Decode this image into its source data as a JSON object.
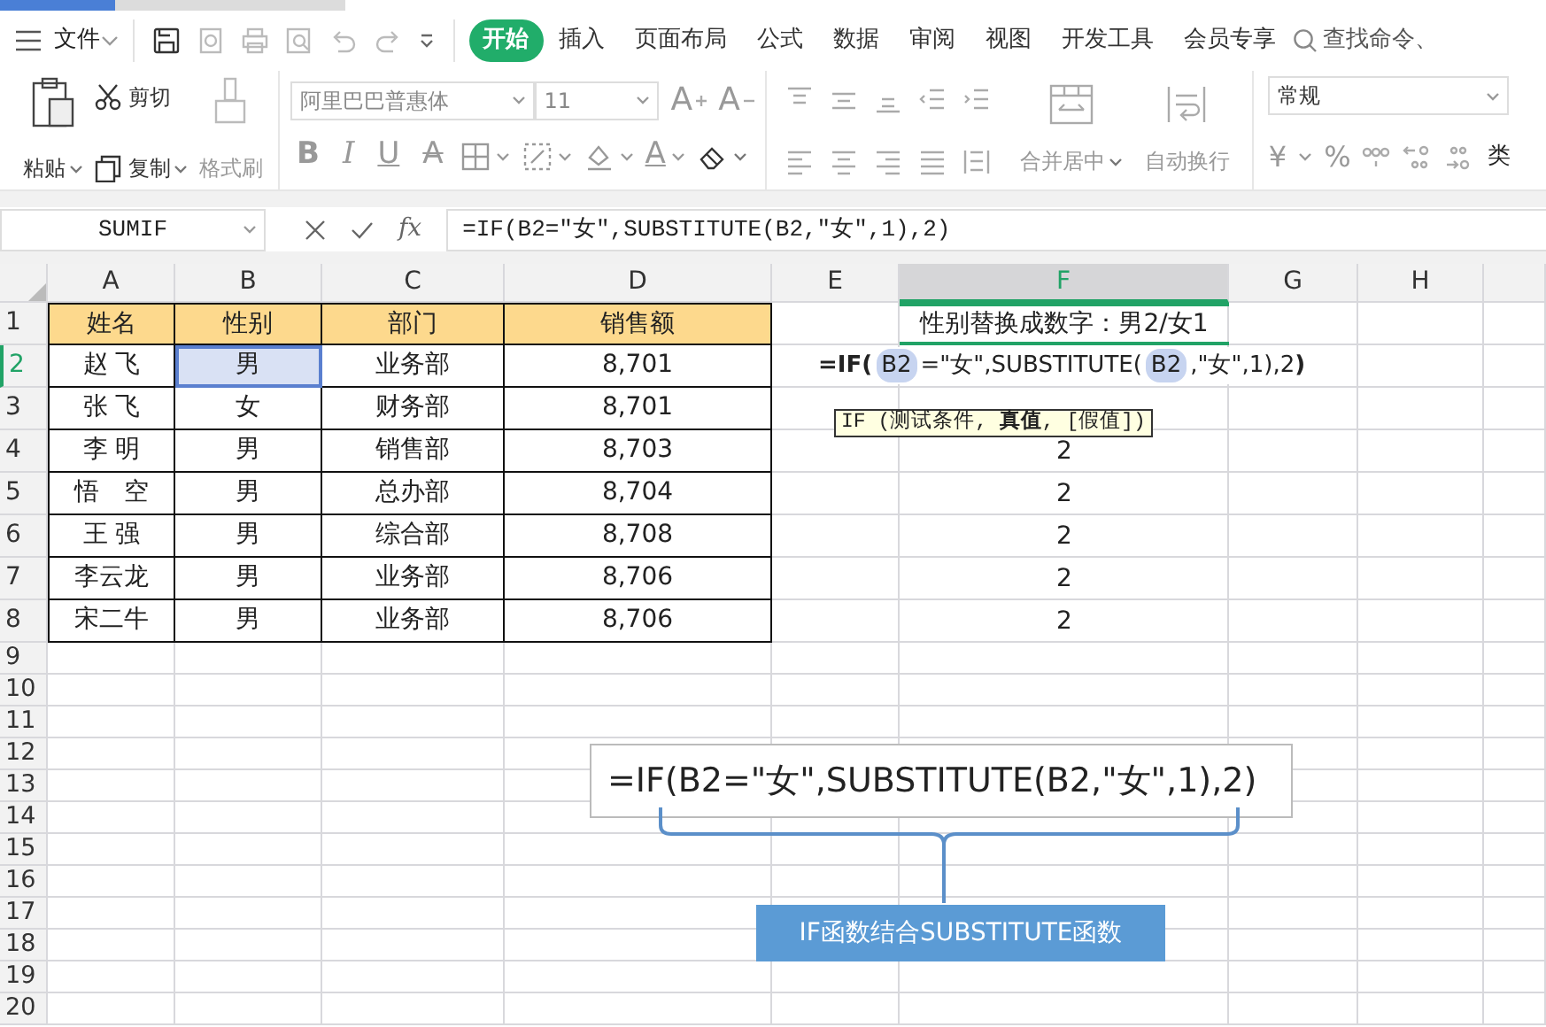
{
  "menu": {
    "file": "文件",
    "tabs": [
      {
        "label": "开始",
        "selected": true
      },
      {
        "label": "插入",
        "selected": false
      },
      {
        "label": "页面布局",
        "selected": false
      },
      {
        "label": "公式",
        "selected": false
      },
      {
        "label": "数据",
        "selected": false
      },
      {
        "label": "审阅",
        "selected": false
      },
      {
        "label": "视图",
        "selected": false
      },
      {
        "label": "开发工具",
        "selected": false
      },
      {
        "label": "会员专享",
        "selected": false
      }
    ],
    "search": "查找命令、"
  },
  "ribbon": {
    "paste": {
      "label": "粘贴",
      "disabled": false
    },
    "cut": {
      "label": "剪切",
      "disabled": false
    },
    "copy": {
      "label": "复制",
      "disabled": false
    },
    "format_painter": {
      "label": "格式刷",
      "disabled": true
    },
    "font_name": "阿里巴巴普惠体",
    "font_size": "11",
    "size_buttons": [
      {
        "label": "A",
        "kind": "grow"
      },
      {
        "label": "A",
        "kind": "shrink"
      }
    ],
    "style_buttons": [
      {
        "label": "B",
        "kind": "bold"
      },
      {
        "label": "I",
        "kind": "italic"
      },
      {
        "label": "U",
        "kind": "underline"
      },
      {
        "label": "A",
        "kind": "strike"
      }
    ],
    "color_button": {
      "label": "A"
    },
    "merge": {
      "label": "合并居中",
      "disabled": true
    },
    "wrap": {
      "label": "自动换行",
      "disabled": true
    },
    "number_format": "常规",
    "currency": "¥",
    "percent": "%",
    "overflow": "类"
  },
  "formula_bar": {
    "name_box": "SUMIF",
    "fx": "fx",
    "formula": "=IF(B2=″女″,SUBSTITUTE(B2,″女″,1),2)"
  },
  "sheet": {
    "columns": [
      {
        "label": "A",
        "selected": false
      },
      {
        "label": "B",
        "selected": false
      },
      {
        "label": "C",
        "selected": false
      },
      {
        "label": "D",
        "selected": false
      },
      {
        "label": "E",
        "selected": false
      },
      {
        "label": "F",
        "selected": true
      },
      {
        "label": "G",
        "selected": false
      },
      {
        "label": "H",
        "selected": false
      }
    ],
    "rows": [
      {
        "label": "1",
        "selected": false,
        "kind": "header",
        "cells": [
          {
            "text": "姓名",
            "selected": false
          },
          {
            "text": "性别",
            "selected": false
          },
          {
            "text": "部门",
            "selected": false
          },
          {
            "text": "销售额",
            "selected": false
          }
        ],
        "result": "性别替换成数字：男2/女1"
      },
      {
        "label": "2",
        "selected": true,
        "kind": "data",
        "cells": [
          {
            "text": "赵 飞",
            "selected": false
          },
          {
            "text": "男",
            "selected": true
          },
          {
            "text": "业务部",
            "selected": false
          },
          {
            "text": "8,701",
            "selected": false
          }
        ]
      },
      {
        "label": "3",
        "selected": false,
        "kind": "data",
        "cells": [
          {
            "text": "张 飞",
            "selected": false
          },
          {
            "text": "女",
            "selected": false
          },
          {
            "text": "财务部",
            "selected": false
          },
          {
            "text": "8,701",
            "selected": false
          }
        ]
      },
      {
        "label": "4",
        "selected": false,
        "kind": "data",
        "cells": [
          {
            "text": "李 明",
            "selected": false
          },
          {
            "text": "男",
            "selected": false
          },
          {
            "text": "销售部",
            "selected": false
          },
          {
            "text": "8,703",
            "selected": false
          }
        ],
        "result": "2"
      },
      {
        "label": "5",
        "selected": false,
        "kind": "data",
        "cells": [
          {
            "text": "悟　空",
            "selected": false
          },
          {
            "text": "男",
            "selected": false
          },
          {
            "text": "总办部",
            "selected": false
          },
          {
            "text": "8,704",
            "selected": false
          }
        ],
        "result": "2"
      },
      {
        "label": "6",
        "selected": false,
        "kind": "data",
        "cells": [
          {
            "text": "王 强",
            "selected": false
          },
          {
            "text": "男",
            "selected": false
          },
          {
            "text": "综合部",
            "selected": false
          },
          {
            "text": "8,708",
            "selected": false
          }
        ],
        "result": "2"
      },
      {
        "label": "7",
        "selected": false,
        "kind": "data",
        "cells": [
          {
            "text": "李云龙",
            "selected": false
          },
          {
            "text": "男",
            "selected": false
          },
          {
            "text": "业务部",
            "selected": false
          },
          {
            "text": "8,706",
            "selected": false
          }
        ],
        "result": "2"
      },
      {
        "label": "8",
        "selected": false,
        "kind": "data",
        "cells": [
          {
            "text": "宋二牛",
            "selected": false
          },
          {
            "text": "男",
            "selected": false
          },
          {
            "text": "业务部",
            "selected": false
          },
          {
            "text": "8,706",
            "selected": false
          }
        ],
        "result": "2"
      },
      {
        "label": "9",
        "selected": false,
        "kind": "blank"
      },
      {
        "label": "10",
        "selected": false,
        "kind": "blank"
      },
      {
        "label": "11",
        "selected": false,
        "kind": "blank"
      },
      {
        "label": "12",
        "selected": false,
        "kind": "blank"
      },
      {
        "label": "13",
        "selected": false,
        "kind": "blank"
      },
      {
        "label": "14",
        "selected": false,
        "kind": "blank"
      },
      {
        "label": "15",
        "selected": false,
        "kind": "blank"
      },
      {
        "label": "16",
        "selected": false,
        "kind": "blank"
      },
      {
        "label": "17",
        "selected": false,
        "kind": "blank"
      },
      {
        "label": "18",
        "selected": false,
        "kind": "blank"
      },
      {
        "label": "19",
        "selected": false,
        "kind": "blank"
      },
      {
        "label": "20",
        "selected": false,
        "kind": "blank"
      }
    ],
    "editor": [
      {
        "text": "=IF(",
        "kind": "bold"
      },
      {
        "text": "B2",
        "kind": "ref"
      },
      {
        "text": "=\"女\",SUBSTITUTE(",
        "kind": "plain"
      },
      {
        "text": "B2",
        "kind": "ref"
      },
      {
        "text": ",\"女\",1),2",
        "kind": "plain"
      },
      {
        "text": ")",
        "kind": "bold"
      }
    ],
    "tooltip": "IF (测试条件, **真值**, [假值])"
  },
  "annotation": {
    "formula": "=IF(B2=\"女\",SUBSTITUTE(B2,\"女\",1),2)",
    "label": "IF函数结合SUBSTITUTE函数"
  }
}
